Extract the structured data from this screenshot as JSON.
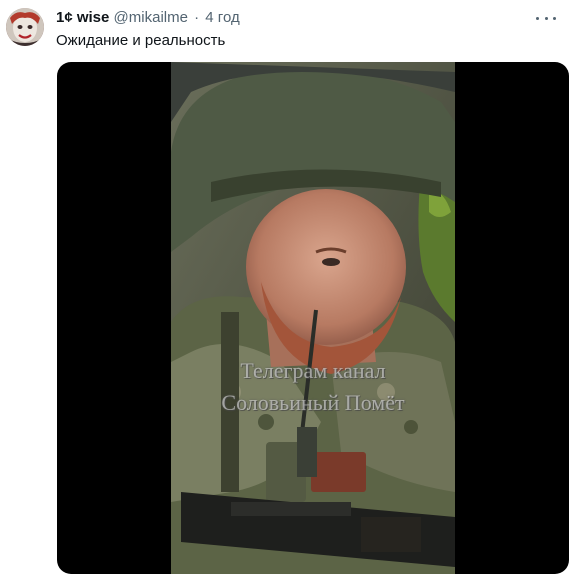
{
  "tweet": {
    "display_name": "1¢ wise",
    "handle": "@mikailme",
    "separator": "·",
    "time": "4 год",
    "text": "Ожидание и реальность"
  },
  "media": {
    "watermark_line1": "Телеграм канал",
    "watermark_line2": "Соловьиный Помёт"
  },
  "colors": {
    "text_primary": "#0f1419",
    "text_secondary": "#536471",
    "media_background": "#000000"
  },
  "icons": {
    "more": "more-horizontal-icon"
  }
}
